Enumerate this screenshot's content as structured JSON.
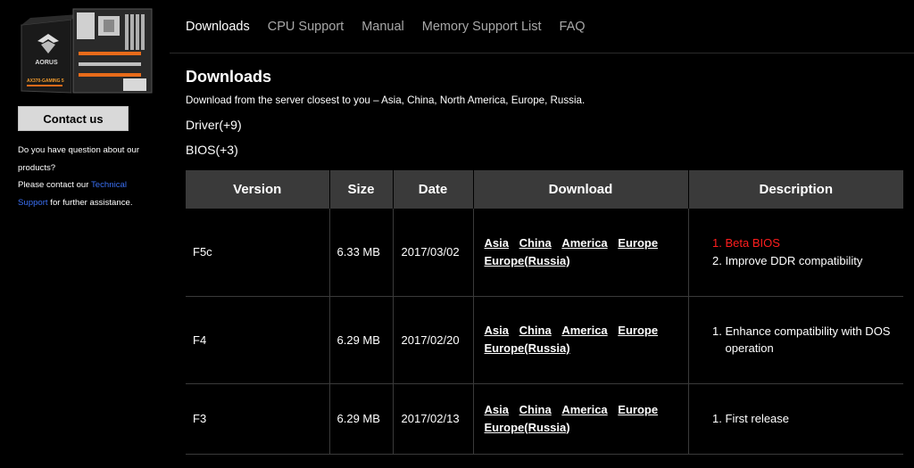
{
  "sidebar": {
    "product_image_alt": "X370-GAMING 5",
    "product_logo_text": "AORUS",
    "product_model_text": "AX370-GAMING 5",
    "contact_button": "Contact us",
    "help_line1": "Do you have question about our products?",
    "help_line2_prefix": "Please contact our",
    "help_link": "Technical Support",
    "help_line2_suffix": "for further assistance."
  },
  "tabs": [
    {
      "label": "Downloads",
      "active": true
    },
    {
      "label": "CPU Support",
      "active": false
    },
    {
      "label": "Manual",
      "active": false
    },
    {
      "label": "Memory Support List",
      "active": false
    },
    {
      "label": "FAQ",
      "active": false
    }
  ],
  "main": {
    "title": "Downloads",
    "description": "Download from the server closest to you – Asia, China, North America, Europe, Russia.",
    "categories": {
      "driver": "Driver(+9)",
      "bios": "BIOS(+3)"
    }
  },
  "table": {
    "headers": {
      "version": "Version",
      "size": "Size",
      "date": "Date",
      "download": "Download",
      "description": "Description"
    },
    "download_links": {
      "asia": "Asia",
      "china": "China",
      "america": "America",
      "europe": "Europe",
      "russia": "Europe(Russia)"
    },
    "rows": [
      {
        "version": "F5c",
        "size": "6.33 MB",
        "date": "2017/03/02",
        "desc1": "Beta BIOS",
        "desc2": "Improve DDR compatibility"
      },
      {
        "version": "F4",
        "size": "6.29 MB",
        "date": "2017/02/20",
        "desc1": "Enhance compatibility with DOS operation"
      },
      {
        "version": "F3",
        "size": "6.29 MB",
        "date": "2017/02/13",
        "desc1": "First release"
      }
    ]
  },
  "colors": {
    "background": "#000000",
    "header_bg": "#3a3a3a",
    "link_blue": "#3a6ff2",
    "beta_red": "#ff1e1e",
    "tab_inactive": "#a8a8a8"
  }
}
